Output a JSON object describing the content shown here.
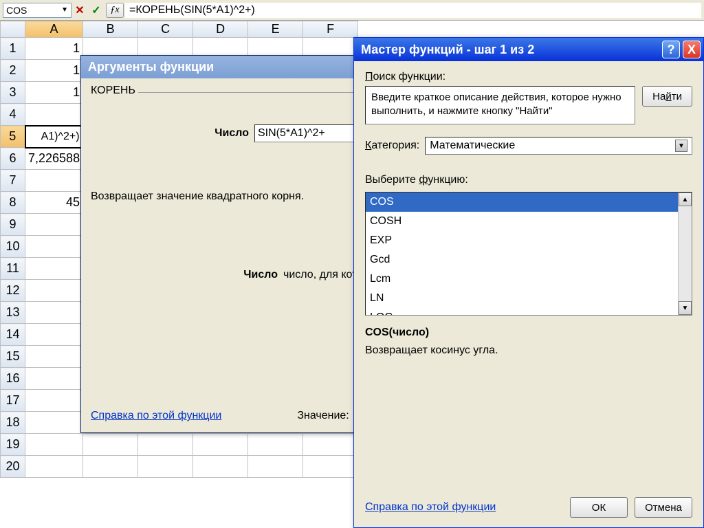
{
  "formula_bar": {
    "name_box": "COS",
    "formula": "=КОРЕНЬ(SIN(5*A1)^2+)"
  },
  "sheet": {
    "columns": [
      "A",
      "B",
      "C",
      "D",
      "E",
      "F"
    ],
    "rows": [
      "1",
      "2",
      "3",
      "4",
      "5",
      "6",
      "7",
      "8",
      "9",
      "10",
      "11",
      "12",
      "13",
      "14",
      "15",
      "16",
      "17",
      "18",
      "19",
      "20"
    ],
    "active_col": "A",
    "active_row": "5",
    "cells": {
      "A1": "1",
      "A2": "1",
      "A3": "1",
      "A5": "A1)^2+)",
      "A6": "7,226588",
      "A8": "45"
    }
  },
  "args_dialog": {
    "title": "Аргументы функции",
    "function_name": "КОРЕНЬ",
    "arg_label": "Число",
    "arg_value": "SIN(5*A1)^2+",
    "description": "Возвращает значение квадратного корня.",
    "arg_desc_label": "Число",
    "arg_desc": "число, для кото",
    "help_link": "Справка по этой функции",
    "value_label": "Значение:"
  },
  "wizard_dialog": {
    "title": "Мастер функций - шаг 1 из 2",
    "search_label_pre": "П",
    "search_label_post": "оиск функции:",
    "search_text": "Введите краткое описание действия, которое нужно выполнить, и нажмите кнопку \"Найти\"",
    "find_button_pre": "На",
    "find_button_u": "й",
    "find_button_post": "ти",
    "category_label_pre": "К",
    "category_label_post": "атегория:",
    "category_value": "Математические",
    "select_label_pre": "Выберите ",
    "select_label_u": "ф",
    "select_label_post": "ункцию:",
    "functions": [
      "COS",
      "COSH",
      "EXP",
      "Gcd",
      "Lcm",
      "LN",
      "LOG"
    ],
    "selected_function": "COS",
    "syntax": "COS(число)",
    "syntax_desc": "Возвращает косинус угла.",
    "help_link": "Справка по этой функции",
    "ok": "ОК",
    "cancel": "Отмена"
  }
}
